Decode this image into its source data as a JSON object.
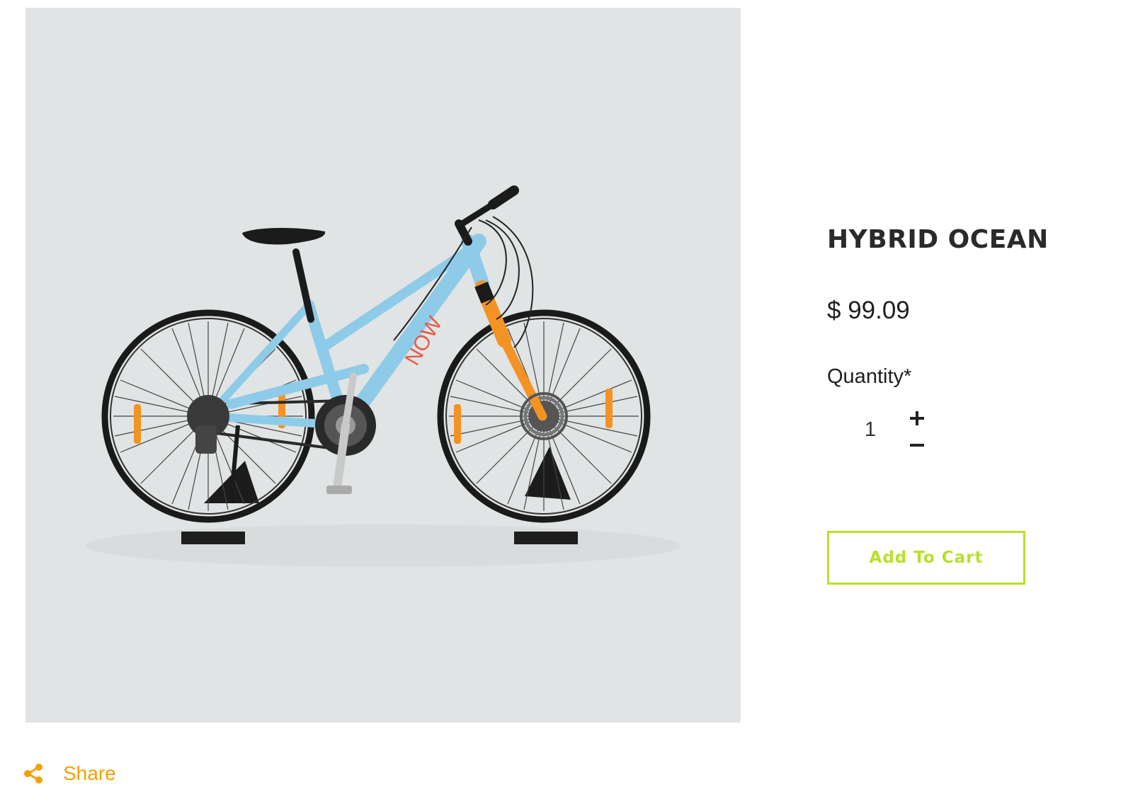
{
  "product": {
    "title": "HYBRID OCEAN",
    "price": "$ 99.09",
    "quantity_label": "Quantity*",
    "quantity_value": "1",
    "add_to_cart_label": "Add To Cart"
  },
  "share": {
    "label": "Share"
  },
  "icons": {
    "increment": "plus-icon",
    "decrement": "minus-icon",
    "share": "share-icon"
  },
  "colors": {
    "accent_green": "#b8e02a",
    "share_orange": "#f5a000",
    "image_background": "#e1e4e4",
    "frame_blue": "#8ecbe8",
    "fork_orange": "#f39323"
  }
}
